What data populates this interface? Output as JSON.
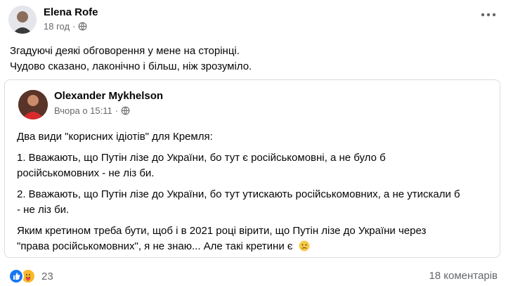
{
  "post": {
    "author": "Elena Rofe",
    "time": "18 год",
    "text_lines": [
      "Згадуючі деякі обговорення у мене на сторінці.",
      "Чудово сказано, лаконічно і більш, ніж зрозуміло."
    ]
  },
  "shared": {
    "author": "Olexander Mykhelson",
    "time": "Вчора о 15:11",
    "p1": "Два види \"корисних ідіотів\" для Кремля:",
    "p2_l1": "1. Вважають, що Путін лізе до України, бо тут є російськомовні, а не було б",
    "p2_l2": "російськомовних - не ліз би.",
    "p3_l1": "2. Вважають, що Путін лізе до України, бо тут утискають російськомовних, а не утискали б",
    "p3_l2": "- не ліз би.",
    "p4_l1": "Яким кретином треба бути, щоб і в 2021 році вірити, що Путін лізе до України через",
    "p4_l2": "\"права російськомовних\", я не знаю... Але такі кретини є"
  },
  "footer": {
    "reactions_count": "23",
    "comments": "18 коментарів"
  },
  "icons": {
    "globe": "globe-icon",
    "more": "more-options-icon",
    "like": "like-reaction-icon",
    "care": "care-reaction-icon",
    "emoji": "sad-face-emoji-icon"
  }
}
